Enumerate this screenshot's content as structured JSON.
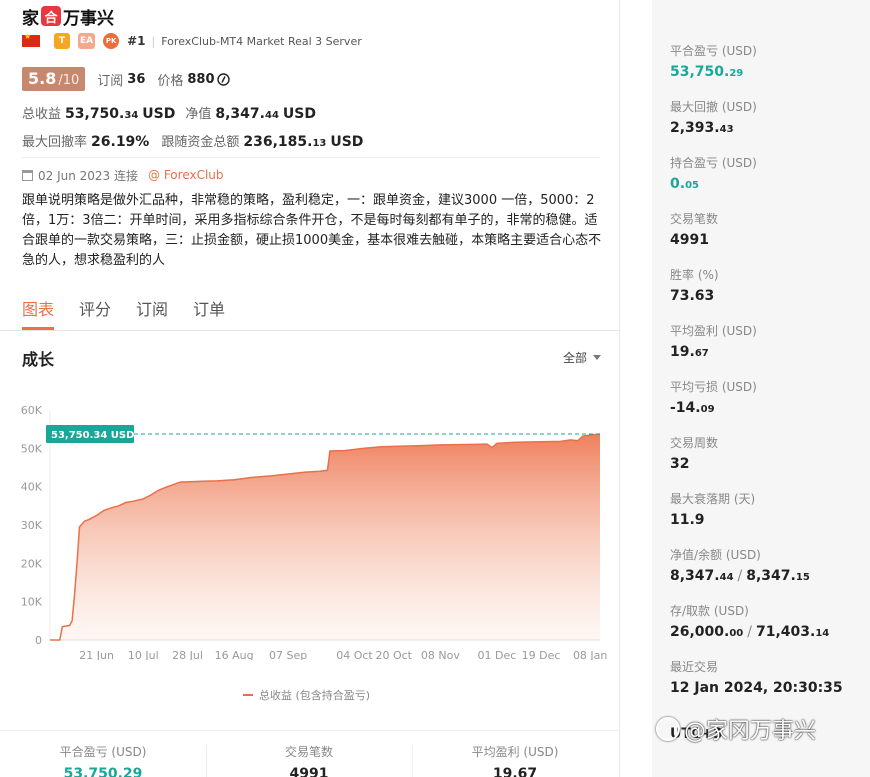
{
  "header": {
    "title_prefix": "家",
    "title_badge": "合",
    "title_suffix": "万事兴",
    "tags": [
      "T",
      "EA",
      "PK"
    ],
    "rank": "#1",
    "server": "ForexClub-MT4 Market Real 3 Server"
  },
  "score": {
    "value": "5.8",
    "max": "/10",
    "subscribe_label": "订阅",
    "subscribe_count": "36",
    "price_label": "价格",
    "price_value": "880"
  },
  "stats": {
    "total_profit_label": "总收益",
    "total_profit_int": "53,750.",
    "total_profit_dec": "34",
    "unit": "USD",
    "net_label": "净值",
    "net_int": "8,347.",
    "net_dec": "44",
    "drawdown_label": "最大回撤率",
    "drawdown_value": "26.19%",
    "follow_label": "跟随资金总额",
    "follow_int": "236,185.",
    "follow_dec": "13"
  },
  "connect": {
    "date_text": "02 Jun 2023 连接",
    "broker_link": "@ ForexClub"
  },
  "description": "跟单说明策略是做外汇品种，非常稳的策略，盈利稳定，一：跟单资金，建议3000 一倍，5000：2倍，1万：3倍二：开单时间，采用多指标综合条件开仓，不是每时每刻都有单子的，非常的稳健。适合跟单的一款交易策略，三：止损金额，硬止损1000美金，基本很难去触碰，本策略主要适合心态不急的人，想求稳盈利的人",
  "tabs": [
    {
      "label": "图表",
      "active": true
    },
    {
      "label": "评分",
      "active": false
    },
    {
      "label": "订阅",
      "active": false
    },
    {
      "label": "订单",
      "active": false
    }
  ],
  "growth": {
    "title": "成长",
    "range_label": "全部",
    "legend_label": "总收益 (包含持合盈亏)"
  },
  "chart_data": {
    "type": "area",
    "series_color": "#e8704a",
    "current_label": "53,750.34 USD",
    "current_value": 53750.34,
    "ylim": [
      0,
      60000
    ],
    "y_ticks": [
      {
        "v": 0,
        "label": "0"
      },
      {
        "v": 10000,
        "label": "10K"
      },
      {
        "v": 20000,
        "label": "20K"
      },
      {
        "v": 30000,
        "label": "30K"
      },
      {
        "v": 40000,
        "label": "40K"
      },
      {
        "v": 50000,
        "label": "50K"
      },
      {
        "v": 60000,
        "label": "60K"
      }
    ],
    "x_ticks": [
      {
        "t": 19,
        "label": "21 Jun"
      },
      {
        "t": 38,
        "label": "10 Jul"
      },
      {
        "t": 56,
        "label": "28 Jul"
      },
      {
        "t": 75,
        "label": "16 Aug"
      },
      {
        "t": 97,
        "label": "07 Sep"
      },
      {
        "t": 124,
        "label": "04 Oct"
      },
      {
        "t": 140,
        "label": "20 Oct"
      },
      {
        "t": 159,
        "label": "08 Nov"
      },
      {
        "t": 182,
        "label": "01 Dec"
      },
      {
        "t": 200,
        "label": "19 Dec"
      },
      {
        "t": 220,
        "label": "08 Jan"
      }
    ],
    "xlim": [
      0,
      224
    ],
    "points": [
      [
        0,
        0
      ],
      [
        4,
        0
      ],
      [
        5,
        3500
      ],
      [
        8,
        3800
      ],
      [
        9,
        5000
      ],
      [
        10,
        12000
      ],
      [
        11,
        20000
      ],
      [
        12,
        29500
      ],
      [
        14,
        31000
      ],
      [
        16,
        31500
      ],
      [
        19,
        32500
      ],
      [
        22,
        33800
      ],
      [
        25,
        34500
      ],
      [
        28,
        35000
      ],
      [
        31,
        35900
      ],
      [
        34,
        36200
      ],
      [
        38,
        36800
      ],
      [
        41,
        37800
      ],
      [
        44,
        39000
      ],
      [
        47,
        39800
      ],
      [
        50,
        40500
      ],
      [
        53,
        41200
      ],
      [
        57,
        41300
      ],
      [
        62,
        41400
      ],
      [
        68,
        41500
      ],
      [
        75,
        41800
      ],
      [
        82,
        42400
      ],
      [
        90,
        42800
      ],
      [
        97,
        43300
      ],
      [
        104,
        43800
      ],
      [
        110,
        44000
      ],
      [
        113,
        44300
      ],
      [
        114,
        49300
      ],
      [
        120,
        49400
      ],
      [
        128,
        50000
      ],
      [
        135,
        50400
      ],
      [
        140,
        50500
      ],
      [
        150,
        50700
      ],
      [
        159,
        50900
      ],
      [
        170,
        51000
      ],
      [
        178,
        51100
      ],
      [
        180,
        50200
      ],
      [
        182,
        51300
      ],
      [
        190,
        51600
      ],
      [
        200,
        51700
      ],
      [
        208,
        51800
      ],
      [
        212,
        52200
      ],
      [
        215,
        52000
      ],
      [
        217,
        53200
      ],
      [
        222,
        53600
      ],
      [
        224,
        53750
      ]
    ]
  },
  "bottom_stats": [
    {
      "label": "平合盈亏 (USD)",
      "value": "53,750.29",
      "accent": true
    },
    {
      "label": "交易笔数",
      "value": "4991",
      "accent": false
    },
    {
      "label": "平均盈利 (USD)",
      "value": "19.67",
      "accent": false
    }
  ],
  "sidebar": {
    "items": [
      {
        "label": "平合盈亏 (USD)",
        "big": "53,750.",
        "small": "29",
        "accent": true
      },
      {
        "label": "最大回撤 (USD)",
        "big": "2,393.",
        "small": "43",
        "accent": false
      },
      {
        "label": "持合盈亏 (USD)",
        "big": "0.",
        "small": "05",
        "accent": true
      },
      {
        "label": "交易笔数",
        "big": "4991",
        "small": "",
        "accent": false
      },
      {
        "label": "胜率 (%)",
        "big": "73.63",
        "small": "",
        "accent": false
      },
      {
        "label": "平均盈利 (USD)",
        "big": "19.",
        "small": "67",
        "accent": false
      },
      {
        "label": "平均亏损 (USD)",
        "big": "-14.",
        "small": "09",
        "accent": false
      },
      {
        "label": "交易周数",
        "big": "32",
        "small": "",
        "accent": false
      },
      {
        "label": "最大衰落期 (天)",
        "big": "11.9",
        "small": "",
        "accent": false
      },
      {
        "label": "净值/余额 (USD)",
        "big": "8,347.",
        "small": "44",
        "big2": "8,347.",
        "small2": "15",
        "accent": false
      },
      {
        "label": "存/取款 (USD)",
        "big": "26,000.",
        "small": "00",
        "big2": "71,403.",
        "small2": "14",
        "accent": false
      },
      {
        "label": "最近交易",
        "big": "12 Jan 2024, 20:30:35",
        "small": "",
        "accent": false
      },
      {
        "label": "",
        "big": "UTC+3",
        "small": "",
        "accent": false
      }
    ]
  },
  "watermark": "@家冈万事兴"
}
